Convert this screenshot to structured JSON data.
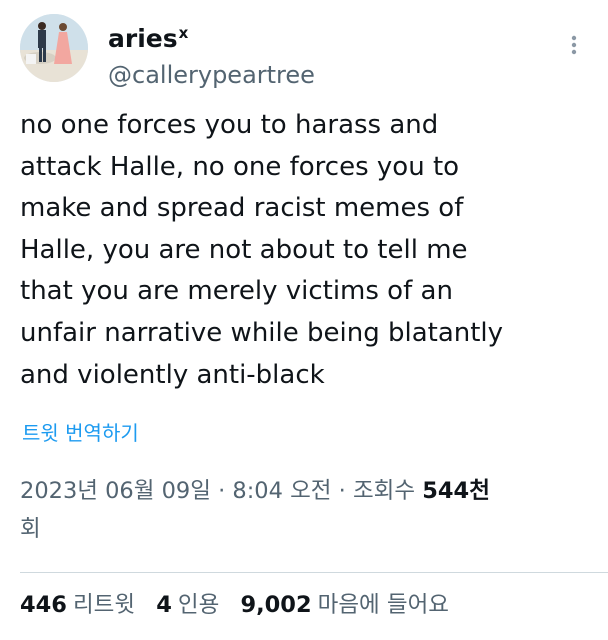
{
  "author": {
    "display_name": "aries",
    "name_badge": "x",
    "handle": "@callerypeartree"
  },
  "icons": {
    "more": "more-dots-icon",
    "avatar": "avatar-photo"
  },
  "tweet": {
    "lines": [
      "no one forces you to harass and",
      "attack Halle, no one forces you to",
      "make and spread racist memes of",
      "Halle, you are not about to tell me",
      "that you are merely victims of an",
      "unfair narrative while being blatantly",
      "and violently anti-black"
    ],
    "translate_label": "트윗 번역하기"
  },
  "meta": {
    "date": "2023년 06월 09일",
    "separator": "·",
    "time": "8:04 오전",
    "views_label": "조회수",
    "views_count": "544천",
    "views_unit": "회"
  },
  "stats": {
    "retweets_count": "446",
    "retweets_label": "리트윗",
    "quotes_count": "4",
    "quotes_label": "인용",
    "likes_count": "9,002",
    "likes_label": "마음에 들어요"
  },
  "colors": {
    "text": "#0f1419",
    "secondary": "#536471",
    "link": "#1d9bf0",
    "divider": "#cfd9de"
  }
}
